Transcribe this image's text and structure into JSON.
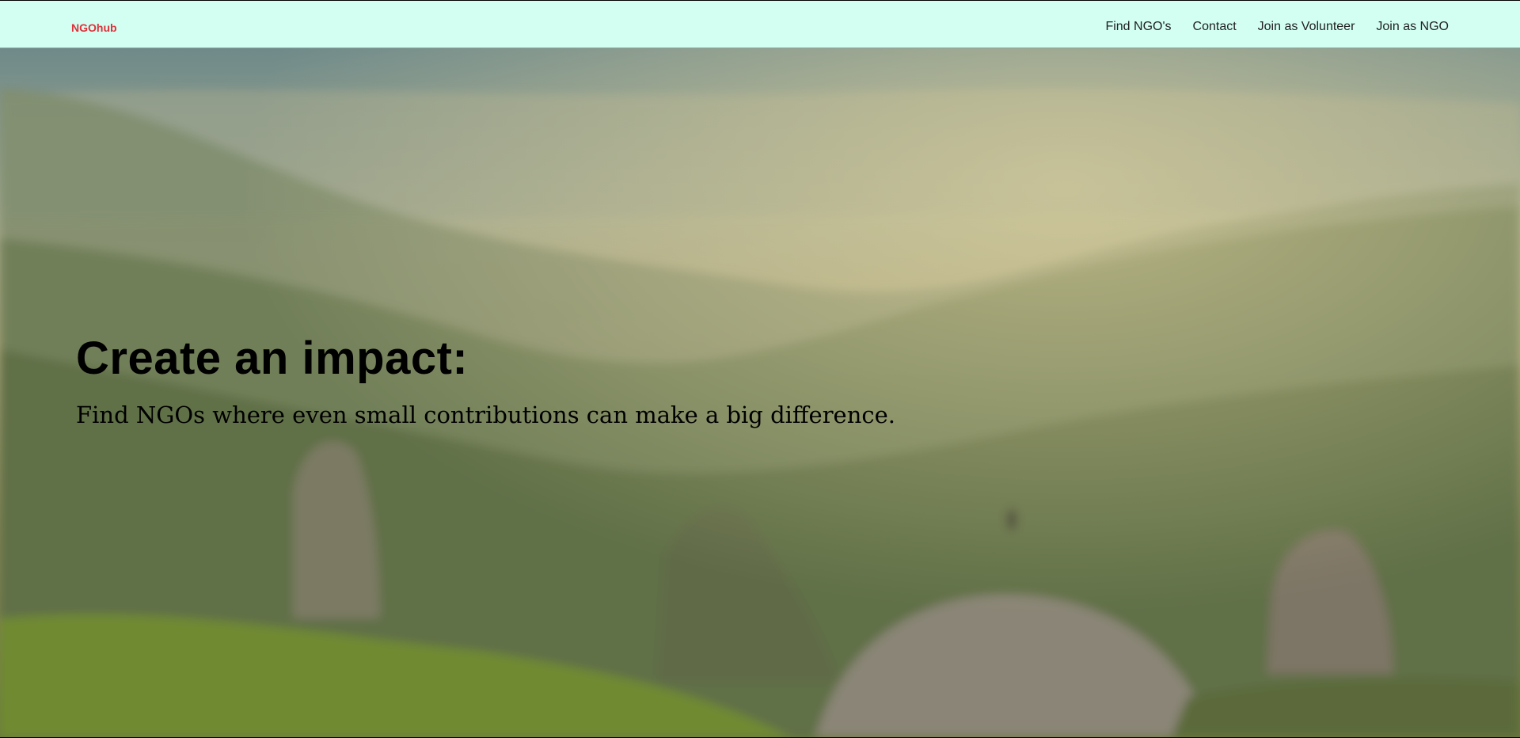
{
  "nav": {
    "brand": "NGOhub",
    "links": [
      {
        "label": "Find NGO's"
      },
      {
        "label": "Contact"
      },
      {
        "label": "Join as Volunteer"
      },
      {
        "label": "Join as NGO"
      }
    ]
  },
  "hero": {
    "title": "Create an impact:",
    "subtitle": "Find NGOs where even small contributions can make a big difference."
  },
  "colors": {
    "nav_bg": "#d2fff2",
    "brand": "#e0303a",
    "text": "#000000"
  }
}
